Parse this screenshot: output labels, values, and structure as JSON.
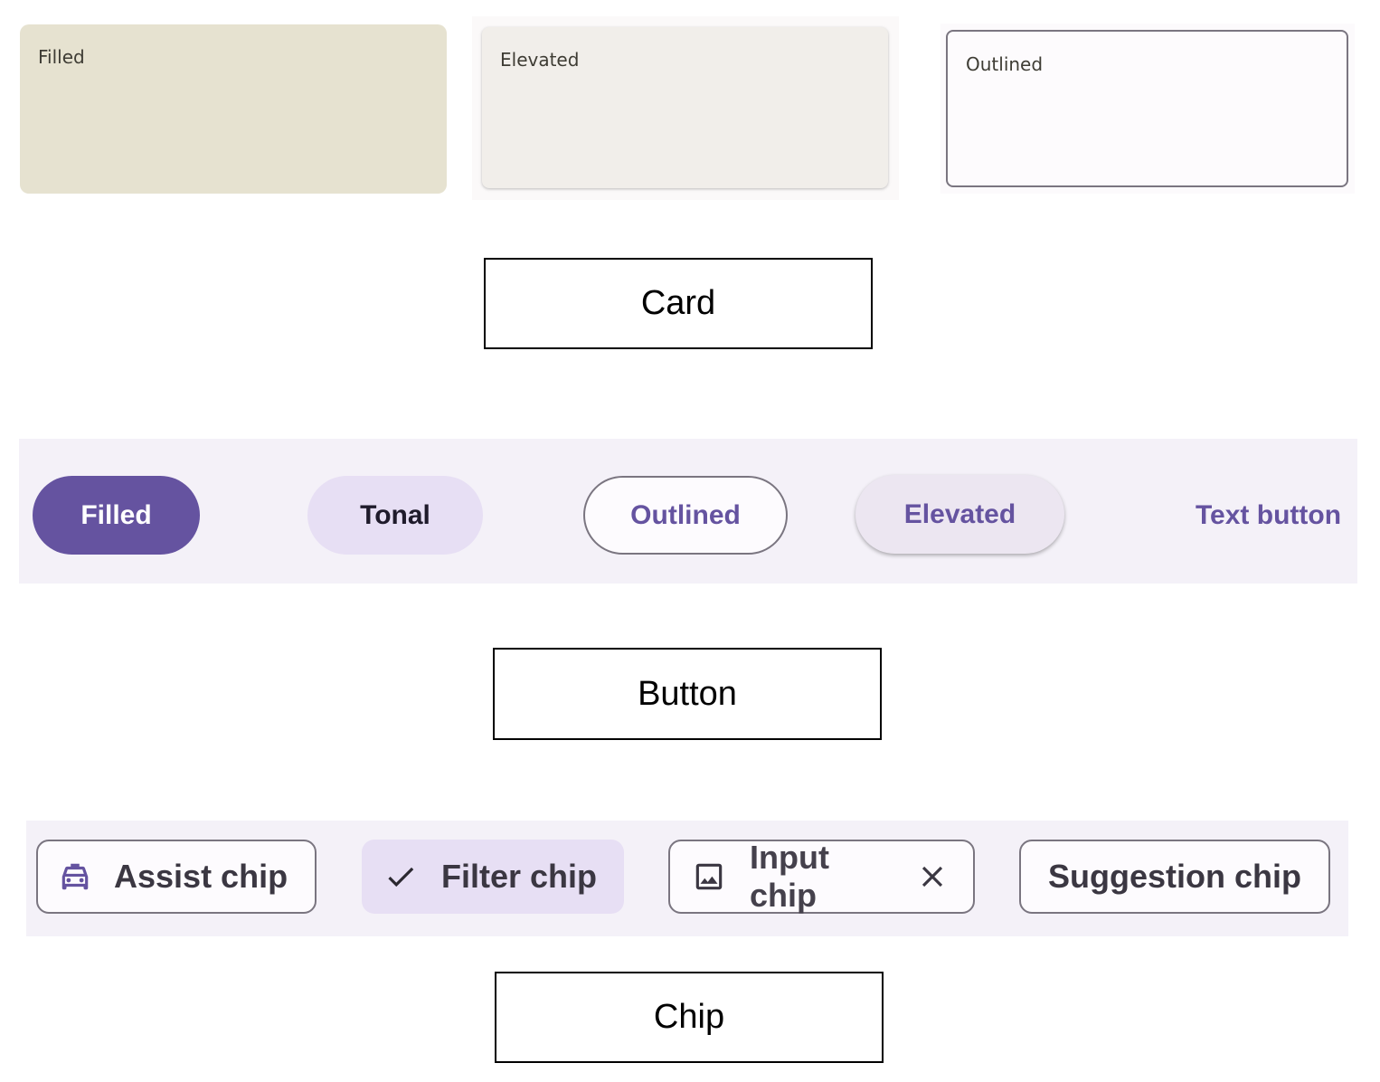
{
  "cards": {
    "filled_label": "Filled",
    "elevated_label": "Elevated",
    "outlined_label": "Outlined",
    "caption": "Card"
  },
  "buttons": {
    "filled_label": "Filled",
    "tonal_label": "Tonal",
    "outlined_label": "Outlined",
    "elevated_label": "Elevated",
    "text_label": "Text button",
    "caption": "Button"
  },
  "chips": {
    "assist_label": "Assist chip",
    "assist_icon": "taxi-icon",
    "filter_label": "Filter chip",
    "filter_icon": "check-icon",
    "input_label": "Input chip",
    "input_icon": "image-icon",
    "input_trailing_icon": "close-icon",
    "suggestion_label": "Suggestion chip",
    "caption": "Chip"
  },
  "colors": {
    "primary": "#6553a0",
    "tonal_container": "#e7dff4",
    "surface_tint": "#f4f1f8",
    "filled_card": "#e6e2d0",
    "elevated_card": "#f1eeea",
    "outline": "#7a7580"
  }
}
